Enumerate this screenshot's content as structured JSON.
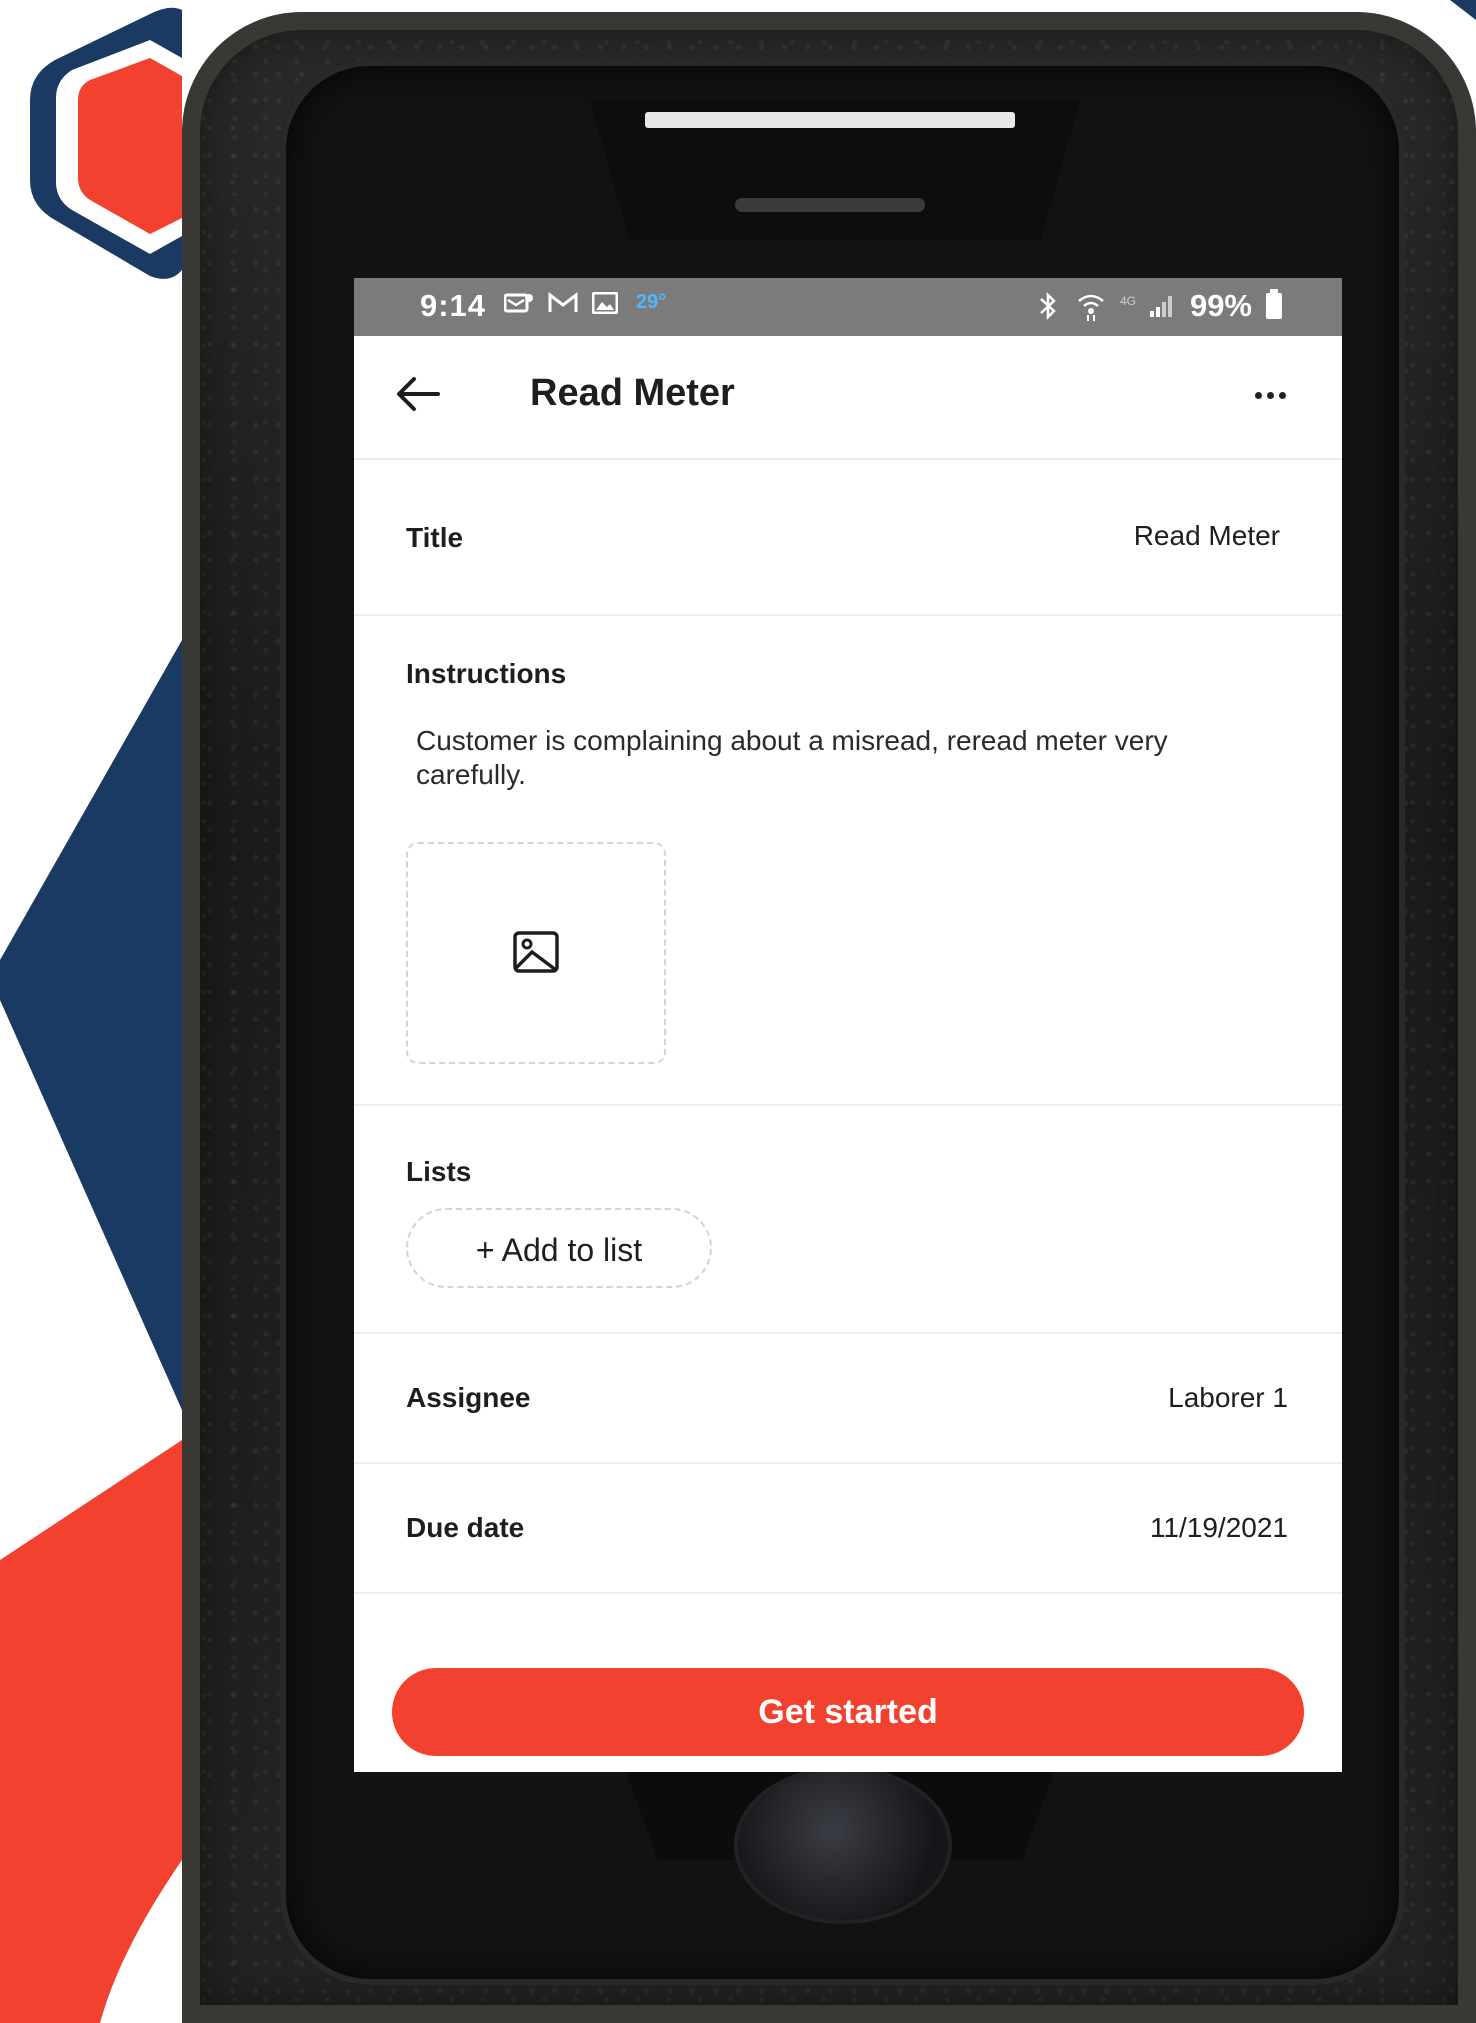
{
  "statusbar": {
    "time": "9:14",
    "temperature": "29°",
    "battery": "99%"
  },
  "appbar": {
    "title": "Read Meter"
  },
  "details": {
    "title_label": "Title",
    "title_value": "Read Meter",
    "instructions_label": "Instructions",
    "instructions_text": "Customer is complaining about a misread, reread meter very carefully.",
    "lists_label": "Lists",
    "add_to_list": "+ Add to list",
    "assignee_label": "Assignee",
    "assignee_value": "Laborer 1",
    "due_label": "Due date",
    "due_value": "11/19/2021"
  },
  "cta": {
    "label": "Get started"
  },
  "colors": {
    "accent": "#f2412f",
    "navy": "#1a3a63",
    "statusbar": "#7b7b7b"
  }
}
